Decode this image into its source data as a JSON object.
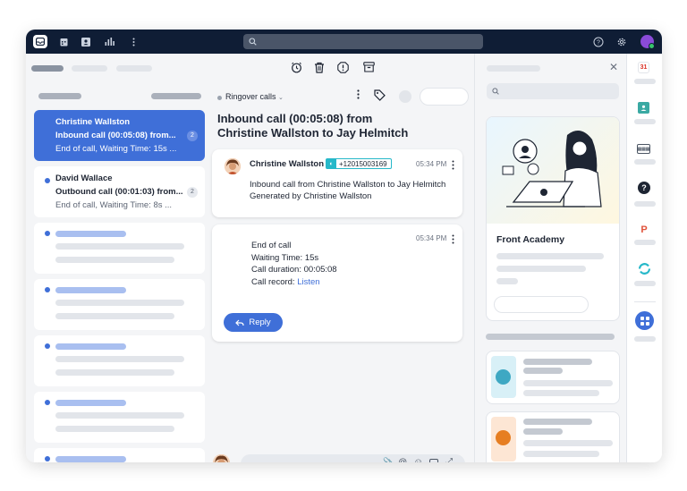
{
  "conversations": [
    {
      "name": "Christine Wallston",
      "subject": "Inbound call  (00:05:08) from...",
      "preview": "End of call, Waiting Time: 15s ...",
      "count": "2"
    },
    {
      "name": "David Wallace",
      "subject": "Outbound call  (00:01:03) from...",
      "preview": "End of call, Waiting Time: 8s ...",
      "count": "2"
    }
  ],
  "inbox_label": "Ringover calls",
  "thread": {
    "title_line1": "Inbound call (00:05:08)  from",
    "title_line2": "Christine Wallston to Jay Helmitch",
    "message1": {
      "sender": "Christine Wallston",
      "phone": "+12015003169",
      "time": "05:34 PM",
      "body_line1": "Inbound call from Christine Wallston to Jay Helmitch",
      "body_line2": "Generated by Christine Wallston"
    },
    "message2": {
      "time": "05:34 PM",
      "line1": "End of call",
      "line2": "Waiting Time: 15s",
      "line3": "Call duration: 00:05:08",
      "line4_label": "Call record: ",
      "line4_link": "Listen"
    },
    "reply_label": "Reply"
  },
  "academy": {
    "title": "Front Academy"
  },
  "rail": {
    "calendar_day": "31",
    "help": "?",
    "p_letter": "P"
  },
  "colors": {
    "accent": "#3f6fd8",
    "topbar": "#0f1d35",
    "phone_badge": "#26b8c9"
  }
}
